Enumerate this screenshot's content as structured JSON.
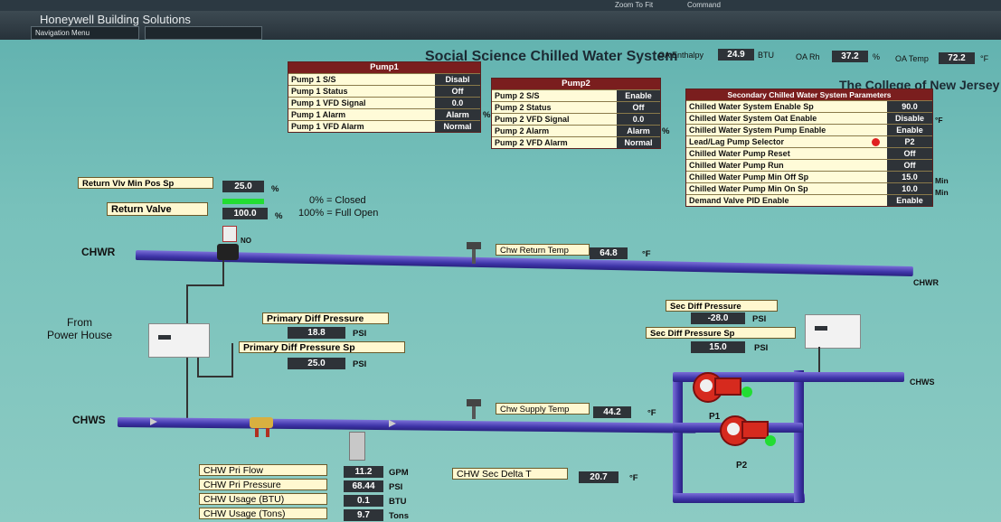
{
  "header": {
    "brand": "Honeywell Building Solutions",
    "nav_menu": "Navigation Menu",
    "zoom_to_fit": "Zoom To Fit",
    "command": "Command"
  },
  "page_title": "Social Science Chilled Water System",
  "college": "The College of New Jersey",
  "oa": {
    "enthalpy_label": "OA Enthalpy",
    "enthalpy_value": "24.9",
    "enthalpy_unit": "BTU",
    "rh_label": "OA Rh",
    "rh_value": "37.2",
    "rh_unit": "%",
    "temp_label": "OA Temp",
    "temp_value": "72.2",
    "temp_unit": "°F"
  },
  "pump1": {
    "title": "Pump1",
    "rows": [
      {
        "label": "Pump 1 S/S",
        "value": "Disabl"
      },
      {
        "label": "Pump 1 Status",
        "value": "Off"
      },
      {
        "label": "Pump 1 VFD Signal",
        "value": "0.0"
      },
      {
        "label": "Pump 1 Alarm",
        "value": "Alarm"
      },
      {
        "label": "Pump 1 VFD Alarm",
        "value": "Normal"
      }
    ],
    "signal_unit": "%"
  },
  "pump2": {
    "title": "Pump2",
    "rows": [
      {
        "label": "Pump 2 S/S",
        "value": "Enable"
      },
      {
        "label": "Pump 2 Status",
        "value": "Off"
      },
      {
        "label": "Pump 2 VFD Signal",
        "value": "0.0"
      },
      {
        "label": "Pump 2 Alarm",
        "value": "Alarm"
      },
      {
        "label": "Pump 2 VFD Alarm",
        "value": "Normal"
      }
    ],
    "signal_unit": "%"
  },
  "secondary": {
    "title": "Secondary Chilled Water System Parameters",
    "rows": [
      {
        "label": "Chilled Water System Enable Sp",
        "value": "90.0",
        "unit": "°F"
      },
      {
        "label": "Chilled Water System Oat Enable",
        "value": "Disable",
        "unit": ""
      },
      {
        "label": "Chilled Water System Pump Enable",
        "value": "Enable",
        "unit": ""
      },
      {
        "label": "Lead/Lag Pump Selector",
        "value": "P2",
        "unit": ""
      },
      {
        "label": "Chilled Water Pump Reset",
        "value": "Off",
        "unit": ""
      },
      {
        "label": "Chilled Water Pump Run",
        "value": "Off",
        "unit": ""
      },
      {
        "label": "Chilled Water Pump Min Off Sp",
        "value": "15.0",
        "unit": "Min"
      },
      {
        "label": "Chilled Water Pump Min On Sp",
        "value": "10.0",
        "unit": "Min"
      },
      {
        "label": "Demand Valve PID Enable",
        "value": "Enable",
        "unit": ""
      }
    ]
  },
  "valve": {
    "min_pos_label": "Return Vlv Min Pos Sp",
    "min_pos_value": "25.0",
    "min_pos_unit": "%",
    "valve_label": "Return Valve",
    "valve_value": "100.0",
    "valve_unit": "%",
    "legend_closed": "0% = Closed",
    "legend_open": "100% = Full Open",
    "no_label": "NO"
  },
  "chwr_label": "CHWR",
  "chwr_right_label": "CHWR",
  "chws_label": "CHWS",
  "chws_right_label": "CHWS",
  "from_power_house": "From\nPower House",
  "return_temp": {
    "label": "Chw Return Temp",
    "value": "64.8",
    "unit": "°F"
  },
  "supply_temp": {
    "label": "Chw Supply Temp",
    "value": "44.2",
    "unit": "°F"
  },
  "primary_dp": {
    "label": "Primary Diff Pressure",
    "value": "18.8",
    "unit": "PSI"
  },
  "primary_dp_sp": {
    "label": "Primary Diff Pressure Sp",
    "value": "25.0",
    "unit": "PSI"
  },
  "sec_dp": {
    "label": "Sec Diff Pressure",
    "value": "-28.0",
    "unit": "PSI"
  },
  "sec_dp_sp": {
    "label": "Sec Diff Pressure Sp",
    "value": "15.0",
    "unit": "PSI"
  },
  "pump_labels": {
    "p1": "P1",
    "p2": "P2"
  },
  "bottom": [
    {
      "label": "CHW Pri Flow",
      "value": "11.2",
      "unit": "GPM"
    },
    {
      "label": "CHW Pri Pressure",
      "value": "68.44",
      "unit": "PSI"
    },
    {
      "label": "CHW Usage (BTU)",
      "value": "0.1",
      "unit": "BTU"
    },
    {
      "label": "CHW Usage (Tons)",
      "value": "9.7",
      "unit": "Tons"
    }
  ],
  "sec_delta": {
    "label": "CHW Sec Delta T",
    "value": "20.7",
    "unit": "°F"
  },
  "colors": {
    "status_on": "#22dd33",
    "alarm_dot": "#e02020",
    "pipe": "#3e34a8"
  }
}
